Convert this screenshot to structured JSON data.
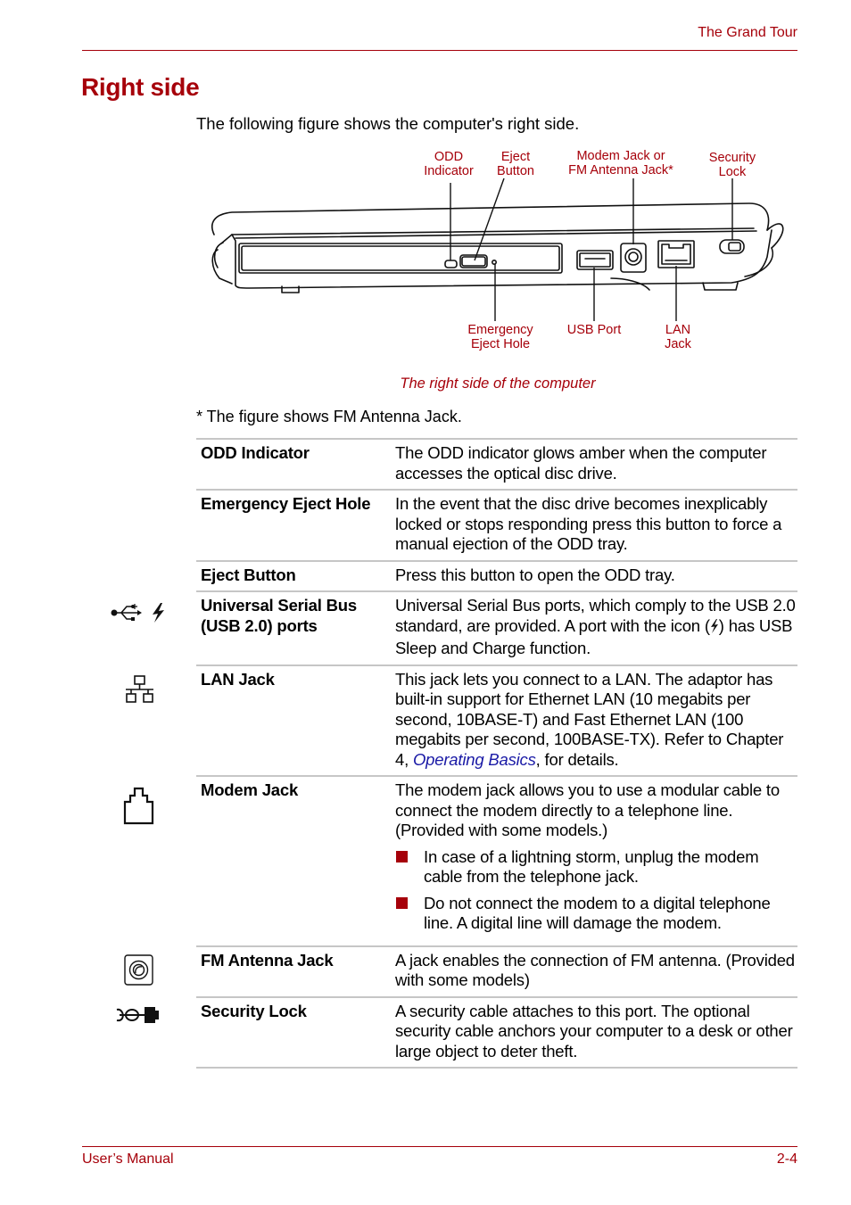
{
  "header": {
    "section_title": "The Grand Tour"
  },
  "page_title": "Right side",
  "intro": "The following figure shows the computer's right side.",
  "figure": {
    "callouts_top": [
      {
        "id": "odd-indicator",
        "lines": [
          "ODD",
          "Indicator"
        ]
      },
      {
        "id": "eject-button",
        "lines": [
          "Eject",
          "Button"
        ]
      },
      {
        "id": "modem-fm-jack",
        "lines": [
          "Modem Jack or",
          "FM Antenna Jack*"
        ]
      },
      {
        "id": "security-lock",
        "lines": [
          "Security",
          "Lock"
        ]
      }
    ],
    "callouts_bottom": [
      {
        "id": "emergency-eject-hole",
        "lines": [
          "Emergency",
          "Eject Hole"
        ]
      },
      {
        "id": "usb-port",
        "lines": [
          "USB Port"
        ]
      },
      {
        "id": "lan-jack",
        "lines": [
          "LAN",
          "Jack"
        ]
      }
    ],
    "caption": "The right side of the computer"
  },
  "footnote": "* The figure shows FM Antenna Jack.",
  "table": {
    "rows": [
      {
        "term": "ODD Indicator",
        "icon": null,
        "desc": "The ODD indicator glows amber when the computer accesses the optical disc drive."
      },
      {
        "term": "Emergency Eject Hole",
        "icon": null,
        "desc": "In the event that the disc drive becomes inexplicably locked or stops responding press this button to force a manual ejection of the ODD tray."
      },
      {
        "term": "Eject Button",
        "icon": null,
        "desc": "Press this button to open the ODD tray."
      },
      {
        "term_line1": "Universal Serial Bus",
        "term_line2": "(USB 2.0) ports",
        "icon": "usb-icon",
        "desc_line1": "Universal Serial Bus ports, which comply to the USB 2.0 standard, are provided. A port with the icon (",
        "desc_line2": ") has USB Sleep and Charge function."
      },
      {
        "term": "LAN Jack",
        "icon": "lan-icon",
        "desc_before_link": "This jack lets you connect to a LAN. The adaptor has built-in support for Ethernet LAN (10 megabits per second, 10BASE-T) and Fast Ethernet LAN (100 megabits per second, 100BASE-TX). Refer to Chapter 4, ",
        "link": "Operating Basics",
        "desc_after_link": ", for details."
      },
      {
        "term": "Modem Jack",
        "icon": "modem-icon",
        "desc": "The modem jack allows you to use a modular cable to connect the modem directly to a telephone line. (Provided with some models.)",
        "bullets": [
          "In case of a lightning storm, unplug the modem cable from the telephone jack.",
          "Do not connect the modem to a digital telephone line. A digital line will damage the modem."
        ]
      },
      {
        "term": "FM Antenna Jack",
        "icon": "fm-antenna-icon",
        "desc": "A jack enables the connection of FM antenna. (Provided with some models)"
      },
      {
        "term": "Security Lock",
        "icon": "security-lock-icon",
        "desc": "A security cable attaches to this port. The optional security cable anchors your computer to a desk or other large object to deter theft."
      }
    ]
  },
  "footer": {
    "left": "User’s Manual",
    "right": "2-4"
  },
  "colors": {
    "accent": "#a6000a",
    "link": "#1a1aa6",
    "rule": "#c6c6c6"
  }
}
